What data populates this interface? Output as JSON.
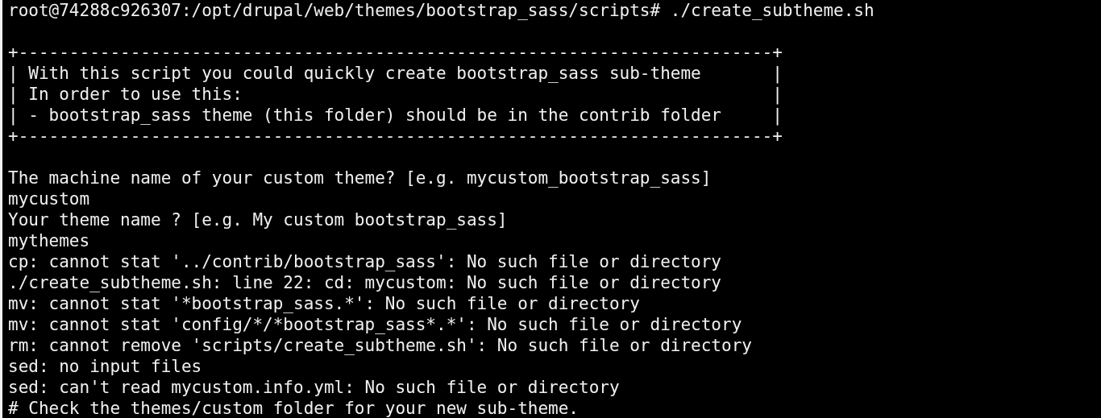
{
  "prompt": "root@74288c926307:/opt/drupal/web/themes/bootstrap_sass/scripts# ./create_subtheme.sh",
  "banner": [
    "+--------------------------------------------------------------------------+",
    "| With this script you could quickly create bootstrap_sass sub-theme       |",
    "| In order to use this:                                                    |",
    "| - bootstrap_sass theme (this folder) should be in the contrib folder     |",
    "+--------------------------------------------------------------------------+"
  ],
  "output": [
    "The machine name of your custom theme? [e.g. mycustom_bootstrap_sass]",
    "mycustom",
    "Your theme name ? [e.g. My custom bootstrap_sass]",
    "mythemes",
    "cp: cannot stat '../contrib/bootstrap_sass': No such file or directory",
    "./create_subtheme.sh: line 22: cd: mycustom: No such file or directory",
    "mv: cannot stat '*bootstrap_sass.*': No such file or directory",
    "mv: cannot stat 'config/*/*bootstrap_sass*.*': No such file or directory",
    "rm: cannot remove 'scripts/create_subtheme.sh': No such file or directory",
    "sed: no input files",
    "sed: can't read mycustom.info.yml: No such file or directory",
    "# Check the themes/custom folder for your new sub-theme."
  ]
}
